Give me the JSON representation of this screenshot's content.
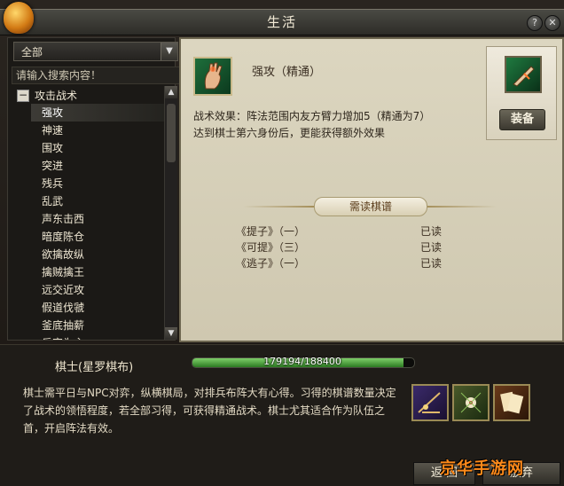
{
  "window": {
    "title": "生活"
  },
  "left": {
    "dropdown_value": "全部",
    "search_placeholder": "请输入搜索内容！",
    "category": "攻击战术",
    "items": [
      "强攻",
      "神速",
      "围攻",
      "突进",
      "残兵",
      "乱武",
      "声东击西",
      "暗度陈仓",
      "欲擒故纵",
      "擒贼擒王",
      "远交近攻",
      "假道伐虢",
      "釜底抽薪",
      "反客为主"
    ],
    "selected_index": 0
  },
  "detail": {
    "skill_name": "强攻（精通）",
    "effect_line1": "战术效果：阵法范围内友方臂力增加5（精通为7）",
    "effect_line2": "达到棋士第六身份后，更能获得额外效果",
    "equip_label": "装备",
    "banner": "需读棋谱",
    "books": [
      {
        "name": "《提子》（一）",
        "status": "已读"
      },
      {
        "name": "《可提》（三）",
        "status": "已读"
      },
      {
        "name": "《逃子》（一）",
        "status": "已读"
      }
    ]
  },
  "profession": {
    "label": "棋士(星罗棋布)",
    "progress_text": "179194/188400",
    "progress_fraction": 0.951,
    "desc": "棋士需平日与NPC对弈，纵横棋局，对排兵布阵大有心得。习得的棋谱数量决定了战术的领悟程度，若全部习得，可获得精通战术。棋士尤其适合作为队伍之首，开启阵法有效。"
  },
  "buttons": {
    "return": "返 回",
    "abandon": "放弃"
  },
  "watermark": "京华手游网"
}
